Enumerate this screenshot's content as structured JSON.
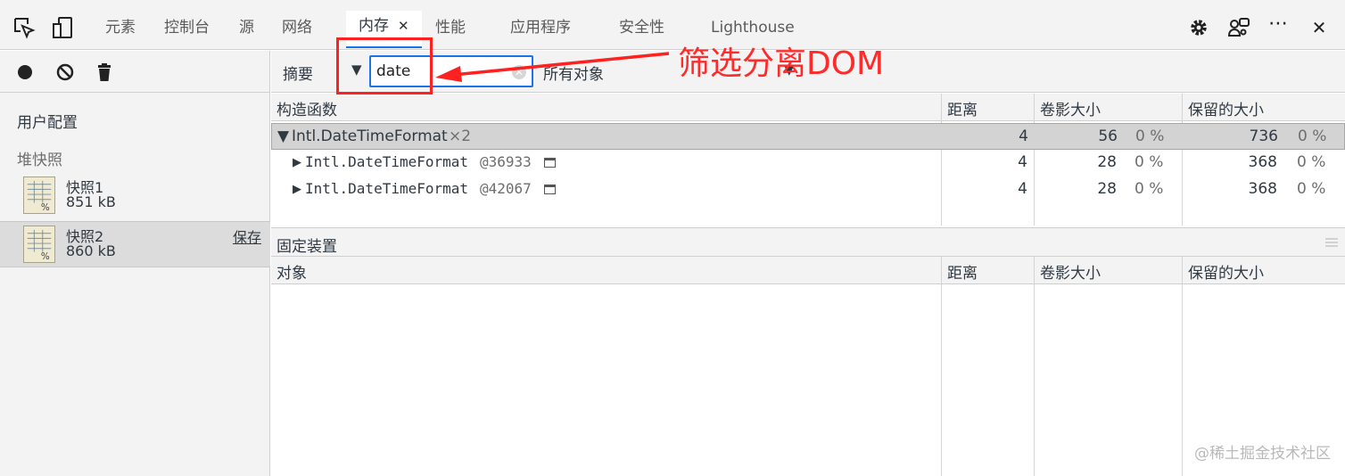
{
  "tabs": [
    {
      "label": "元素"
    },
    {
      "label": "控制台"
    },
    {
      "label": "源"
    },
    {
      "label": "网络"
    },
    {
      "label": "内存",
      "active": true
    },
    {
      "label": "性能"
    },
    {
      "label": "应用程序"
    },
    {
      "label": "安全性"
    },
    {
      "label": "Lighthouse"
    }
  ],
  "tab_close_glyph": "✕",
  "top_icons": [
    "inspect-element-icon",
    "device-toolbar-icon",
    "settings-gear-icon",
    "remote-devices-icon",
    "more-options-icon",
    "close-devtools-icon"
  ],
  "more_glyph": "⋯",
  "close_glyph": "✕",
  "sidebar": {
    "toolbar_icons": [
      "record-icon",
      "clear-icon",
      "trash-icon"
    ],
    "profiles_heading": "用户配置",
    "heap_heading": "堆快照",
    "snapshots": [
      {
        "name": "快照1",
        "size": "851 kB",
        "selected": false
      },
      {
        "name": "快照2",
        "size": "860 kB",
        "selected": true,
        "save_label": "保存"
      }
    ]
  },
  "filterbar": {
    "view": "摘要",
    "view_caret": "▼",
    "filter_value": "date",
    "object_select": "所有对象",
    "select_caret": "▼"
  },
  "table": {
    "headers": {
      "constructor": "构造函数",
      "distance": "距离",
      "shallow": "卷影大小",
      "retained": "保留的大小"
    },
    "rows": [
      {
        "arrow": "▼",
        "name": "Intl.DateTimeFormat",
        "suffix": "×2",
        "distance": "4",
        "shallow": "56",
        "shallow_pct": "0 %",
        "retained": "736",
        "retained_pct": "0 %",
        "selected": true
      },
      {
        "arrow": "▶",
        "name": "Intl.DateTimeFormat",
        "suffix": "@36933",
        "distance": "4",
        "shallow": "28",
        "shallow_pct": "0 %",
        "retained": "368",
        "retained_pct": "0 %"
      },
      {
        "arrow": "▶",
        "name": "Intl.DateTimeFormat",
        "suffix": "@42067",
        "distance": "4",
        "shallow": "28",
        "shallow_pct": "0 %",
        "retained": "368",
        "retained_pct": "0 %"
      }
    ]
  },
  "retainers": {
    "title": "固定装置",
    "headers": {
      "object": "对象",
      "distance": "距离",
      "shallow": "卷影大小",
      "retained": "保留的大小"
    }
  },
  "annotation": {
    "text": "筛选分离DOM",
    "color": "#ff2a2a"
  },
  "watermark": "@稀土掘金技术社区",
  "colors": {
    "accent": "#1a73e8",
    "panel_bg": "#f3f3f3",
    "selected_row": "#d3d3d3"
  }
}
